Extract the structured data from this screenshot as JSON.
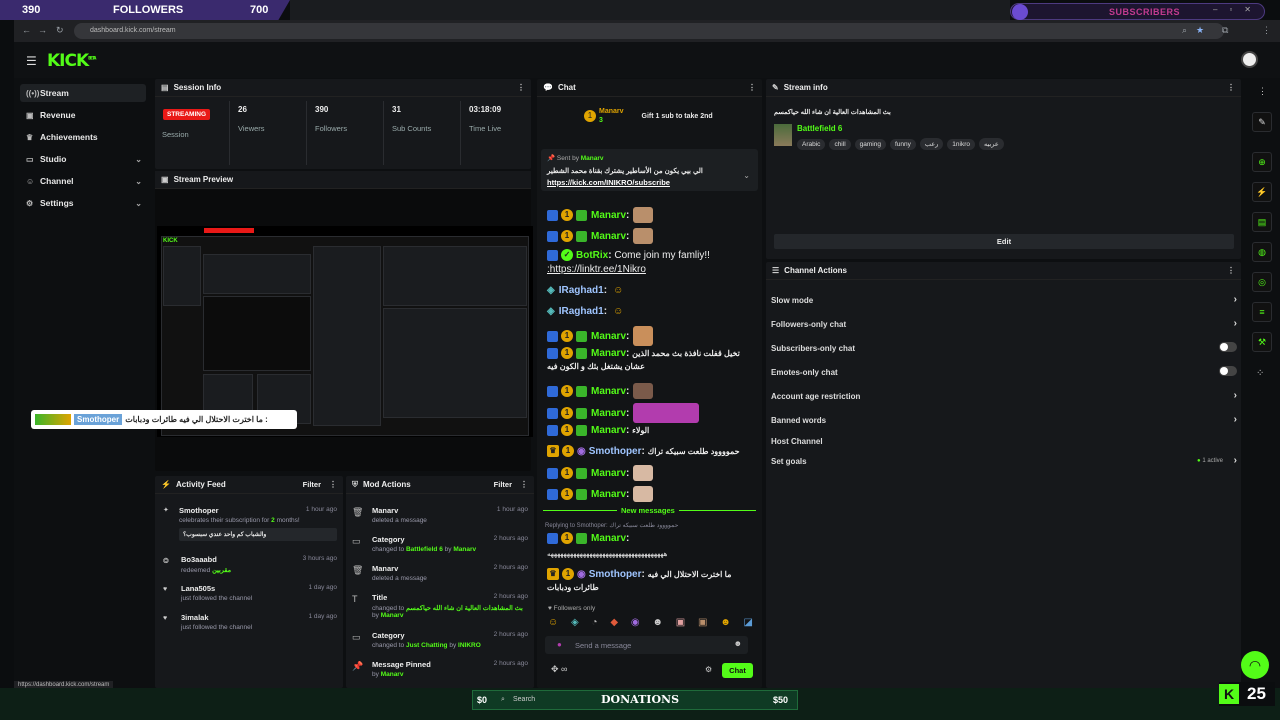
{
  "overlay": {
    "left_count": "390",
    "followers_label": "FOLLOWERS",
    "right_count": "700",
    "subscribers_label": "SUBSCRIBERS"
  },
  "browser": {
    "url": "dashboard.kick.com/stream",
    "status_url": "https://dashboard.kick.com/stream"
  },
  "brand": {
    "logo": "KICK",
    "beta": "BETA",
    "accent": "#53fc18"
  },
  "sidebar": {
    "items": [
      {
        "label": "Stream",
        "icon": "broadcast-icon"
      },
      {
        "label": "Revenue",
        "icon": "wallet-icon"
      },
      {
        "label": "Achievements",
        "icon": "trophy-icon"
      },
      {
        "label": "Studio",
        "icon": "tv-icon"
      },
      {
        "label": "Channel",
        "icon": "user-icon"
      },
      {
        "label": "Settings",
        "icon": "gear-icon"
      }
    ]
  },
  "session": {
    "title": "Session Info",
    "live_badge": "STREAMING",
    "session_label": "Session",
    "stats": [
      {
        "value": "26",
        "label": "Viewers"
      },
      {
        "value": "390",
        "label": "Followers"
      },
      {
        "value": "31",
        "label": "Sub Counts"
      },
      {
        "value": "03:18:09",
        "label": "Time Live"
      }
    ]
  },
  "preview": {
    "title": "Stream Preview"
  },
  "toast": {
    "username": "Smothoper",
    "message": "ما اخترت الاحتلال الي فيه طائرات ودبابات :"
  },
  "activity": {
    "title": "Activity Feed",
    "filter": "Filter",
    "items": [
      {
        "name": "Smothoper",
        "desc": "celebrates their subscription for",
        "highlight": "2",
        "desc2": "months!",
        "time": "1 hour ago",
        "quote": "والشباب كم واحد عندي سبسوب؟"
      },
      {
        "name": "Bo3aaabd",
        "desc": "redeemed",
        "highlight": "مقربين",
        "time": "3 hours ago"
      },
      {
        "name": "Lana505s",
        "desc": "just followed the channel",
        "time": "1 day ago"
      },
      {
        "name": "3imalak",
        "desc": "just followed the channel",
        "time": "1 day ago"
      }
    ]
  },
  "mod": {
    "title": "Mod Actions",
    "filter": "Filter",
    "items": [
      {
        "name": "Manarv",
        "desc": "deleted a message",
        "time": "1 hour ago"
      },
      {
        "name": "Category",
        "desc": "changed to",
        "hl": "Battlefield 6",
        "by": "by",
        "who": "Manarv",
        "time": "2 hours ago"
      },
      {
        "name": "Manarv",
        "desc": "deleted a message",
        "time": "2 hours ago"
      },
      {
        "name": "Title",
        "desc": "changed to",
        "hl": "بث المشاهدات العالية ان شاء الله حياكمسم",
        "by": "by",
        "who": "Manarv",
        "time": "2 hours ago"
      },
      {
        "name": "Category",
        "desc": "changed to",
        "hl": "Just Chatting",
        "by": "by",
        "who": "INIKRO",
        "time": "2 hours ago"
      },
      {
        "name": "Message Pinned",
        "desc": "by",
        "who": "Manarv",
        "time": "2 hours ago"
      }
    ]
  },
  "chat": {
    "title": "Chat",
    "gifter": {
      "name": "Manarv",
      "count": "3",
      "label": "Gift 1 sub to take 2nd"
    },
    "pinned": {
      "sent_by": "Sent by",
      "user": "Manarv",
      "text": "الي بيي يكون من الأساطير يشترك بقناة محمد الشطير",
      "link": "https://kick.com/INIKRO/subscribe"
    },
    "messages": [
      {
        "user": "Manarv",
        "color": "#53fc18",
        "text": ""
      },
      {
        "user": "Manarv",
        "color": "#53fc18",
        "text": ""
      },
      {
        "user": "BotRix",
        "color": "#53fc18",
        "text": "Come join my famliy!!"
      },
      {
        "user": "",
        "color": "#fff",
        "text": ":https://linktr.ee/1Nikro"
      },
      {
        "user": "IRaghad1",
        "color": "#9fc5ff",
        "text": ""
      },
      {
        "user": "IRaghad1",
        "color": "#9fc5ff",
        "text": ""
      },
      {
        "user": "Manarv",
        "color": "#53fc18",
        "text": ""
      },
      {
        "user": "Manarv",
        "color": "#53fc18",
        "text": "تخيل قفلت نافذة بث محمد الذين"
      },
      {
        "user": "",
        "color": "#fff",
        "text": "عشان يشتغل بثك و الكون فيه"
      },
      {
        "user": "Manarv",
        "color": "#53fc18",
        "text": ""
      },
      {
        "user": "Manarv",
        "color": "#53fc18",
        "text": ""
      },
      {
        "user": "Manarv",
        "color": "#53fc18",
        "text": "الولاء"
      },
      {
        "user": "Smothoper",
        "color": "#9fc5ff",
        "text": "حموووود طلعت سبيكه تراك"
      },
      {
        "user": "Manarv",
        "color": "#53fc18",
        "text": ""
      },
      {
        "user": "Manarv",
        "color": "#53fc18",
        "text": ""
      }
    ],
    "new_messages": "New messages",
    "replying": "Replying to Smothoper: حموووود طلعت سبيكه تراك",
    "reply_user": "Manarv",
    "reply_text": "ههههههههههههههههههههههههههههههههههههه",
    "last_user": "Smothoper",
    "last_text": "ما اخترت الاحتلال الي فيه",
    "last_text2": "طائرات ودبابات",
    "followers_only": "Followers only",
    "placeholder": "Send a message",
    "send": "Chat"
  },
  "stream_info": {
    "title": "Stream info",
    "stream_title": "بث المشاهدات العالية ان شاء الله حياكمسم",
    "category": "Battlefield 6",
    "tags": [
      "Arabic",
      "chill",
      "gaming",
      "funny",
      "رعب",
      "1nikro",
      "عربيه"
    ],
    "edit": "Edit"
  },
  "channel_actions": {
    "title": "Channel Actions",
    "rows": [
      {
        "label": "Slow mode",
        "kind": "chevron"
      },
      {
        "label": "Followers-only chat",
        "kind": "chevron"
      },
      {
        "label": "Subscribers-only chat",
        "kind": "toggle"
      },
      {
        "label": "Emotes-only chat",
        "kind": "toggle"
      },
      {
        "label": "Account age restriction",
        "kind": "chevron"
      },
      {
        "label": "Banned words",
        "kind": "chevron"
      },
      {
        "label": "Host Channel",
        "kind": "none"
      },
      {
        "label": "Set goals",
        "kind": "chevron",
        "status": "1 active"
      }
    ]
  },
  "taskbar": {
    "donation_label": "DONATIONS",
    "left_amount": "$0",
    "right_amount": "$50",
    "search": "Search",
    "viewer_count": "25"
  }
}
